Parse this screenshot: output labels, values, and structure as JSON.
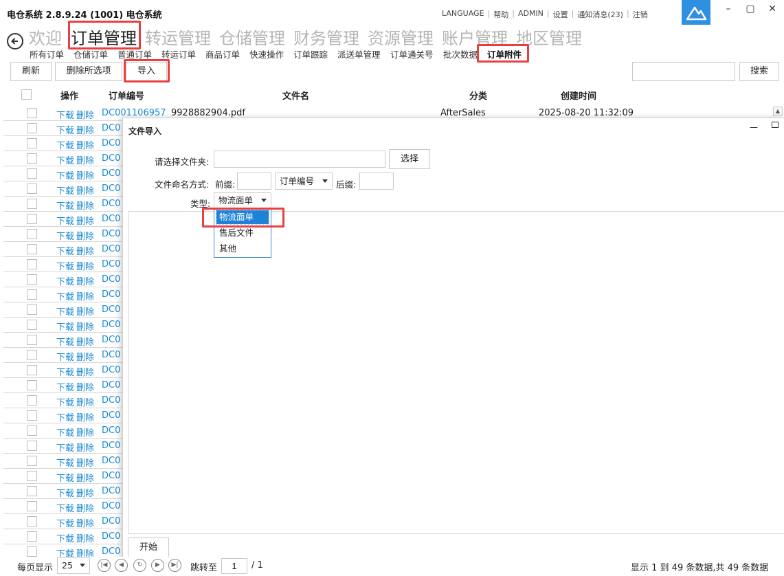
{
  "window": {
    "title": "电仓系统 2.8.9.24 (1001) 电仓系统",
    "top_links": [
      "LANGUAGE",
      "帮助",
      "ADMIN",
      "设置",
      "通知消息(23)",
      "注销"
    ]
  },
  "nav": {
    "main": [
      "欢迎",
      "订单管理",
      "转运管理",
      "仓储管理",
      "财务管理",
      "资源管理",
      "账户管理",
      "地区管理"
    ],
    "active_main": "订单管理",
    "sub": [
      "所有订单",
      "仓储订单",
      "普通订单",
      "转运订单",
      "商品订单",
      "快速操作",
      "订单跟踪",
      "派送单管理",
      "订单通关号",
      "批次数据",
      "订单附件"
    ],
    "active_sub": "订单附件"
  },
  "toolbar": {
    "refresh_label": "刷新",
    "delete_selected_label": "删除所选项",
    "import_label": "导入",
    "search_label": "搜索",
    "search_value": ""
  },
  "table": {
    "headers": {
      "action": "操作",
      "order_no": "订单编号",
      "filename": "文件名",
      "category": "分类",
      "created": "创建时间"
    },
    "download_label": "下载",
    "delete_label": "删除",
    "first_row": {
      "order_no": "DC001106957",
      "filename": "9928882904.pdf",
      "category": "AfterSales",
      "created": "2025-08-20 11:32:09"
    },
    "order_prefix_visible": "DC0",
    "visible_row_count": 30
  },
  "dialog": {
    "title": "文件导入",
    "folder_label": "请选择文件夹:",
    "folder_value": "",
    "choose_label": "选择",
    "naming_label": "文件命名方式:",
    "prefix_label": "前缀:",
    "prefix_value": "",
    "naming_select": "订单编号",
    "suffix_label": "后缀:",
    "suffix_value": "",
    "type_label": "类型:",
    "type_value": "物流面单",
    "type_options": [
      "物流面单",
      "售后文件",
      "其他"
    ],
    "start_label": "开始"
  },
  "footer": {
    "page_size_label": "每页显示",
    "page_size": "25",
    "goto_label": "跳转至",
    "page": "1",
    "total_pages": "/ 1",
    "summary": "显示 1 到 49 条数据,共 49 条数据"
  },
  "colors": {
    "link": "#1a8ad4",
    "highlight_box": "#e84040",
    "logo": "#2f8fe0",
    "selected_option": "#1e82d8"
  }
}
